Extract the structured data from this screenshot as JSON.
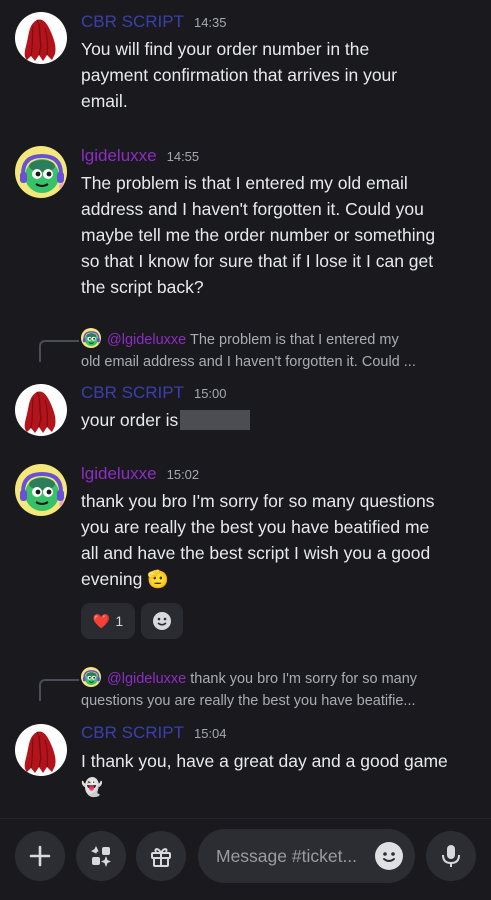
{
  "messages": [
    {
      "author": "CBR SCRIPT",
      "time": "14:35",
      "lines": [
        "You will find your order number in the",
        "payment confirmation that arrives in your",
        "email."
      ]
    },
    {
      "author": "lgideluxxe",
      "time": "14:55",
      "lines": [
        "The problem is that I entered my old email",
        "address and I haven't forgotten it. Could you",
        "maybe tell me the order number or something",
        "so that I know for sure that if I lose it I can get",
        "the script back?"
      ]
    },
    {
      "reply": {
        "mention": "@lgideluxxe",
        "line1": " The problem is that I entered my",
        "line2": "old email address and I haven't forgotten it. Could ..."
      },
      "author": "CBR SCRIPT",
      "time": "15:00",
      "text": "your order is"
    },
    {
      "author": "lgideluxxe",
      "time": "15:02",
      "lines": [
        "thank you bro I'm sorry for so many questions",
        "you are really the best you have beatified me",
        "all and have the best script I wish you a good",
        "evening 🫡"
      ],
      "reactions": [
        {
          "emoji": "❤️",
          "count": "1"
        }
      ]
    },
    {
      "reply": {
        "mention": "@lgideluxxe",
        "line1": " thank you bro I'm sorry for so many",
        "line2": "questions you are really the best you have beatifie..."
      },
      "author": "CBR SCRIPT",
      "time": "15:04",
      "lines": [
        "I thank you, have a great day and a good game",
        "👻"
      ]
    }
  ],
  "composer": {
    "placeholder": "Message #ticket..."
  },
  "colors": {
    "background": "#1a1a1e",
    "cbr_name": "#3b3fae",
    "lgi_name": "#8d2cc3"
  },
  "icons": [
    "plus-icon",
    "apps-icon",
    "gift-icon",
    "emoji-icon",
    "microphone-icon",
    "add-reaction-icon",
    "heart-emoji"
  ]
}
